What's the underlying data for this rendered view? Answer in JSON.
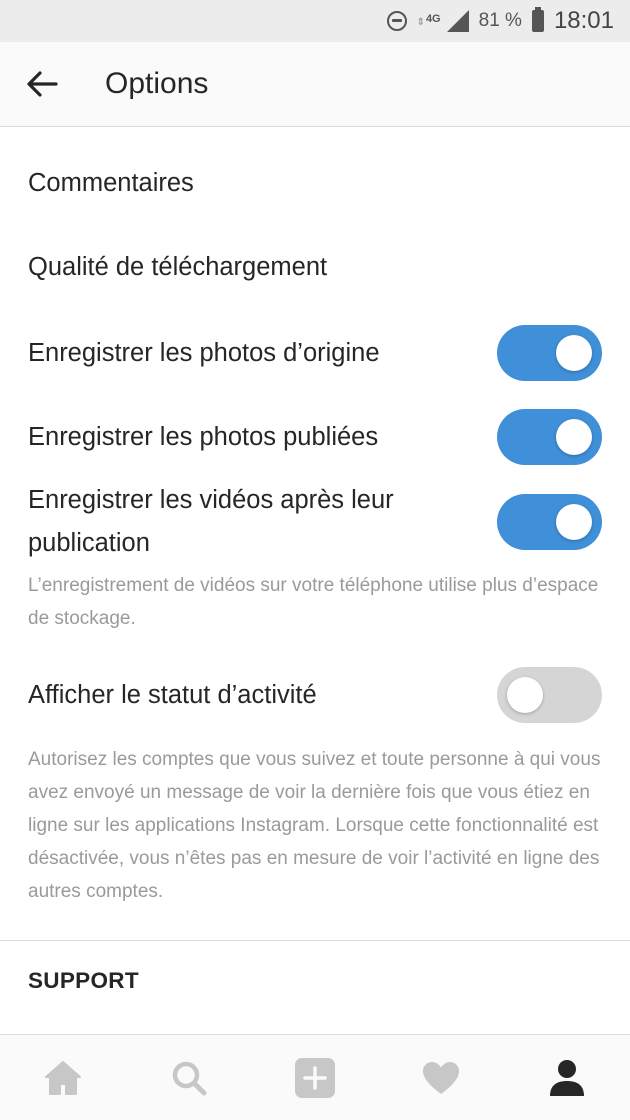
{
  "status_bar": {
    "network": "4G",
    "battery": "81 %",
    "time": "18:01"
  },
  "header": {
    "title": "Options",
    "back_icon": "arrow-left-icon"
  },
  "settings": {
    "comments": "Commentaires",
    "upload_quality": "Qualité de téléchargement",
    "save_original_photos": {
      "label": "Enregistrer les photos d’origine",
      "on": true
    },
    "save_posted_photos": {
      "label": "Enregistrer les photos publiées",
      "on": true
    },
    "save_videos": {
      "label": "Enregistrer les vidéos après leur publication",
      "on": true
    },
    "save_videos_help": "L’enregistrement de vidéos sur votre téléphone utilise plus d’espace de stockage.",
    "activity_status": {
      "label": "Afficher le statut d’activité",
      "on": false
    },
    "activity_status_help": "Autorisez les comptes que vous suivez et toute personne à qui vous avez envoyé un message de voir la dernière fois que vous étiez en ligne sur les applications Instagram. Lorsque cette fonctionnalité est désactivée, vous n’êtes pas en mesure de voir l’activité en ligne des autres comptes."
  },
  "support_section": {
    "title": "SUPPORT"
  },
  "tab_bar": {
    "icons": [
      "home-icon",
      "search-icon",
      "add-post-icon",
      "heart-icon",
      "profile-icon"
    ]
  },
  "colors": {
    "toggle_on": "#3f8fd9",
    "toggle_off": "#d5d5d5",
    "help_text": "#9a9a9a"
  }
}
